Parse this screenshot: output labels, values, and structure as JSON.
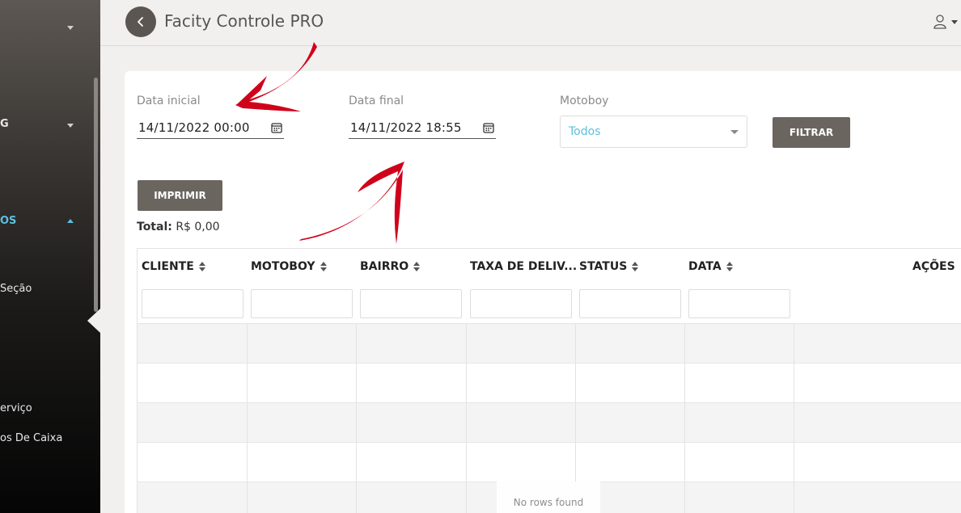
{
  "sidebar": {
    "items": [
      {
        "label": "",
        "caret": "down"
      },
      {
        "label": "G",
        "caret": "down"
      },
      {
        "label": "OS",
        "caret": "up"
      },
      {
        "label": " Seção"
      },
      {
        "label": "erviço"
      },
      {
        "label": "os De Caixa"
      }
    ]
  },
  "header": {
    "back_icon": "chevron-left-icon",
    "title": "Facity Controle PRO",
    "user_icon": "user-icon"
  },
  "filters": {
    "start_label": "Data inicial",
    "start_value": "14/11/2022 00:00",
    "end_label": "Data final",
    "end_value": "14/11/2022 18:55",
    "motoboy_label": "Motoboy",
    "motoboy_value": "Todos",
    "filter_button": "FILTRAR",
    "print_button": "IMPRIMIR"
  },
  "total": {
    "label": "Total:",
    "value": "R$ 0,00"
  },
  "table": {
    "columns": [
      "CLIENTE",
      "MOTOBOY",
      "BAIRRO",
      "TAXA DE DELIV...",
      "STATUS",
      "DATA"
    ],
    "actions_label": "AÇÕES",
    "empty_message": "No rows found"
  },
  "colors": {
    "sidebar_top": "#5d5853",
    "sidebar_bottom": "#050505",
    "button_bg": "#6b6560",
    "accent": "#5bc0de",
    "annotation_arrow": "#d0021b"
  }
}
